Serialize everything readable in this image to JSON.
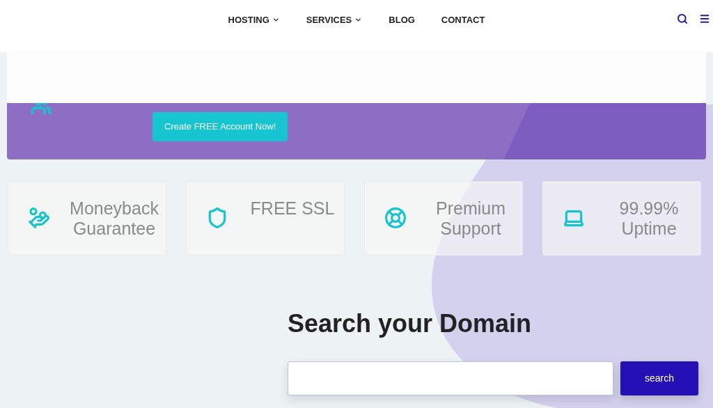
{
  "nav": {
    "items": [
      {
        "label": "HOSTING",
        "dropdown": true
      },
      {
        "label": "SERVICES",
        "dropdown": true
      },
      {
        "label": "BLOG",
        "dropdown": false
      },
      {
        "label": "CONTACT",
        "dropdown": false
      }
    ]
  },
  "banner": {
    "button": "Create FREE Account Now!"
  },
  "features": [
    {
      "title": "Moneyback Guarantee"
    },
    {
      "title": "FREE SSL"
    },
    {
      "title": "Premium Support"
    },
    {
      "title": "99.99% Uptime"
    }
  ],
  "domain_search": {
    "heading": "Search your Domain",
    "button": "search"
  }
}
